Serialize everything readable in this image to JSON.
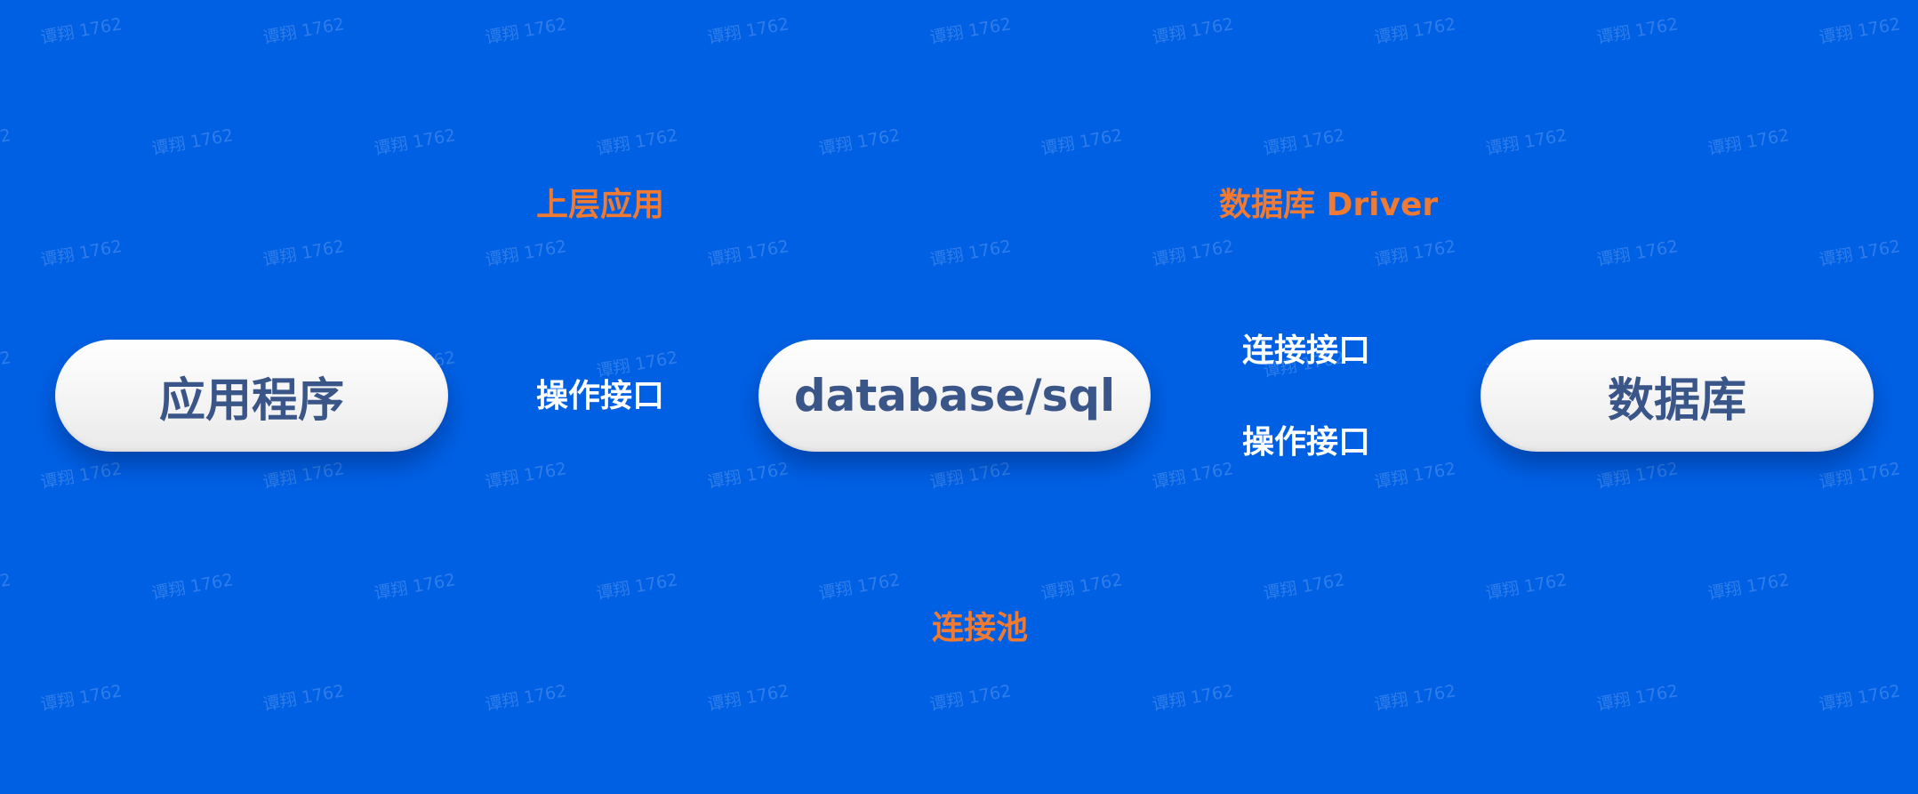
{
  "nodes": {
    "app": "应用程序",
    "sql": "database/sql",
    "db": "数据库"
  },
  "labels": {
    "upper_app": "上层应用",
    "db_driver": "数据库 Driver",
    "op_interface_left": "操作接口",
    "conn_interface_right": "连接接口",
    "op_interface_right": "操作接口",
    "conn_pool": "连接池"
  },
  "watermark_text": "谭翔 1762",
  "colors": {
    "background": "#0060e4",
    "orange_label": "#ee7a33",
    "white_label": "#ffffff",
    "pill_text": "#3a5588"
  }
}
